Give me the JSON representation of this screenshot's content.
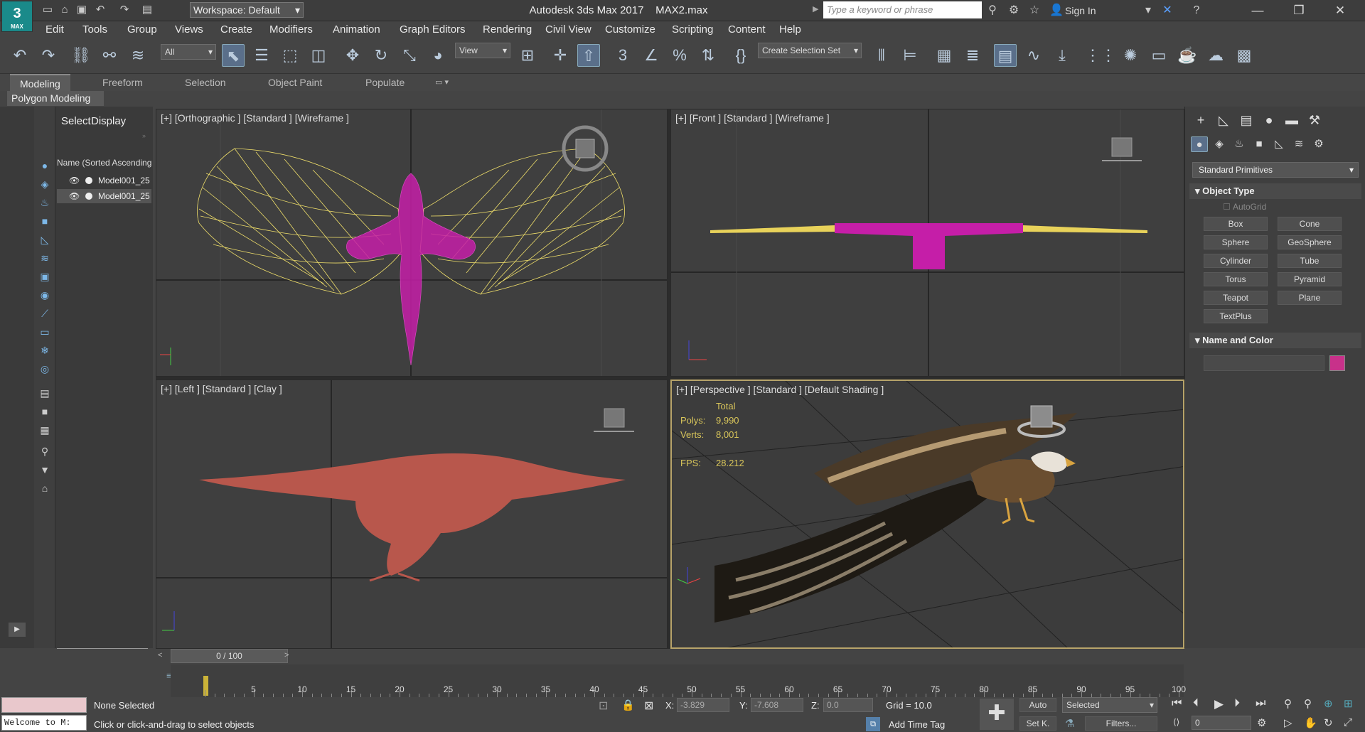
{
  "titlebar": {
    "logo": "3",
    "logo_sub": "MAX",
    "workspace": "Workspace: Default",
    "title": "Autodesk 3ds Max 2017",
    "file": "MAX2.max",
    "search_placeholder": "Type a keyword or phrase",
    "signin": "Sign In"
  },
  "menus": [
    "Edit",
    "Tools",
    "Group",
    "Views",
    "Create",
    "Modifiers",
    "Animation",
    "Graph Editors",
    "Rendering",
    "Civil View",
    "Customize",
    "Scripting",
    "Content",
    "Help"
  ],
  "toolbar": {
    "filter": "All",
    "refcoord": "View",
    "selset": "Create Selection Set"
  },
  "ribbon": {
    "tabs": [
      "Modeling",
      "Freeform",
      "Selection",
      "Object Paint",
      "Populate"
    ],
    "active": "Modeling",
    "panel": "Polygon Modeling"
  },
  "scene": {
    "tabs": [
      "Select",
      "Display"
    ],
    "header": "Name (Sorted Ascending)",
    "rows": [
      "Model001_25",
      "Model001_25"
    ]
  },
  "viewports": {
    "top_left": "[+] [Orthographic ] [Standard ] [Wireframe ]",
    "top_right": "[+] [Front ] [Standard ] [Wireframe ]",
    "bottom_left": "[+] [Left ] [Standard ] [Clay ]",
    "bottom_right": "[+] [Perspective ] [Standard ] [Default Shading ]",
    "stats": {
      "total_label": "Total",
      "polys_label": "Polys:",
      "polys": "9,990",
      "verts_label": "Verts:",
      "verts": "8,001",
      "fps_label": "FPS:",
      "fps": "28.212"
    }
  },
  "command": {
    "category": "Standard Primitives",
    "object_type_title": "Object Type",
    "autogrid": "AutoGrid",
    "buttons": [
      "Box",
      "Cone",
      "Sphere",
      "GeoSphere",
      "Cylinder",
      "Tube",
      "Torus",
      "Pyramid",
      "Teapot",
      "Plane",
      "TextPlus"
    ],
    "name_color_title": "Name and Color",
    "color": "#c8318a"
  },
  "timeline": {
    "slider": "0 / 100",
    "ticks": [
      "5",
      "10",
      "15",
      "20",
      "25",
      "30",
      "35",
      "40",
      "45",
      "50",
      "55",
      "60",
      "65",
      "70",
      "75",
      "80",
      "85",
      "90",
      "95",
      "100"
    ]
  },
  "status": {
    "maxscript": "Welcome to M:",
    "selection": "None Selected",
    "prompt": "Click or click-and-drag to select objects",
    "x_label": "X:",
    "x": "-3.829",
    "y_label": "Y:",
    "y": "-7.608",
    "z_label": "Z:",
    "z": "0.0",
    "grid": "Grid = 10.0",
    "add_time_tag": "Add Time Tag",
    "auto": "Auto",
    "set_key": "Set K.",
    "selected_mode": "Selected",
    "filters": "Filters...",
    "frame": "0"
  }
}
